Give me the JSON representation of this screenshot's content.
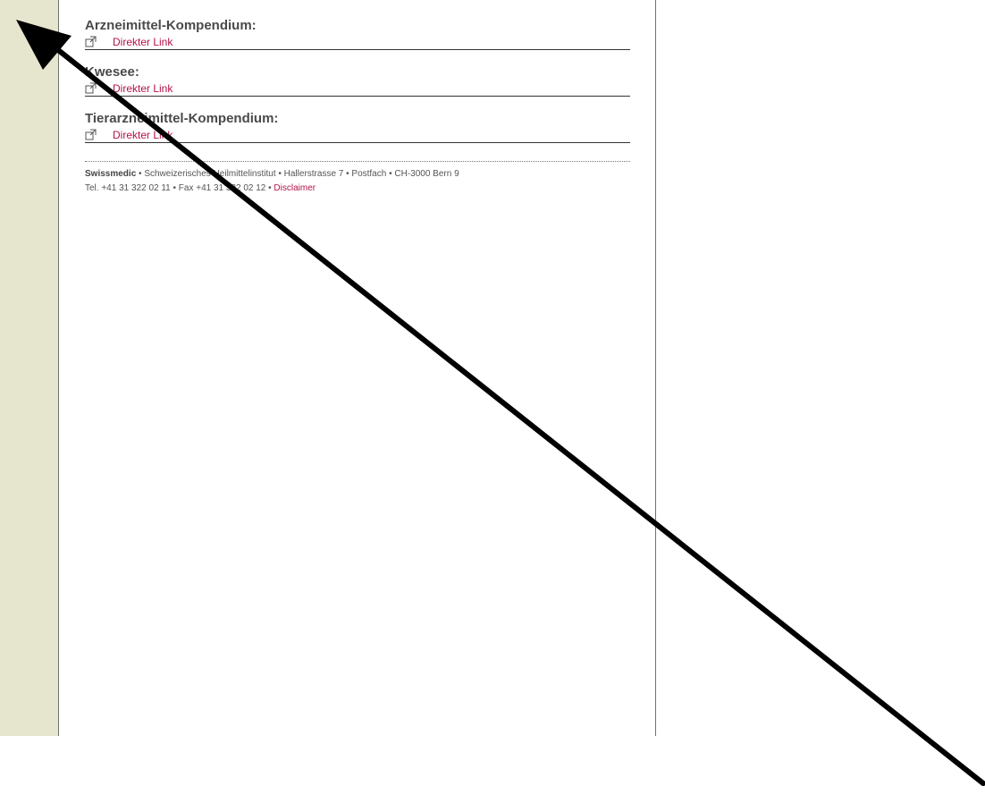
{
  "sections": [
    {
      "title": "Arzneimittel-Kompendium:",
      "link_label": "Direkter Link"
    },
    {
      "title": "Kwesee:",
      "link_label": "Direkter Link"
    },
    {
      "title": "Tierarzneimittel-Kompendium:",
      "link_label": "Direkter Link"
    }
  ],
  "footer": {
    "org": "Swissmedic",
    "address": " • Schweizerisches Heilmittelinstitut • Hallerstrasse 7 • Postfach • CH-3000 Bern 9",
    "contact": "Tel. +41 31 322 02 11 • Fax +41 31 322 02 12 • ",
    "disclaimer": "Disclaimer"
  },
  "colors": {
    "link": "#b5124a",
    "sidebar_bg": "#e6e6cf"
  }
}
